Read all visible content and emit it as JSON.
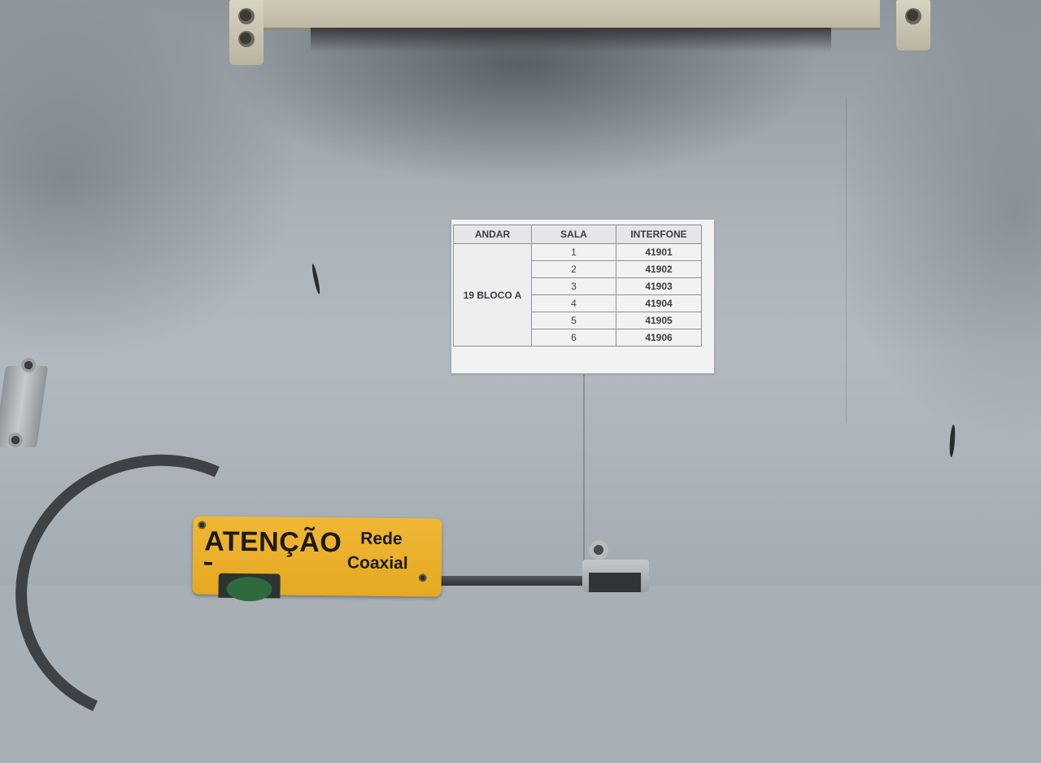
{
  "label_sheet": {
    "headers": [
      "ANDAR",
      "SALA",
      "INTERFONE"
    ],
    "andar": "19 BLOCO A",
    "rows": [
      {
        "sala": "1",
        "interfone": "41901"
      },
      {
        "sala": "2",
        "interfone": "41902"
      },
      {
        "sala": "3",
        "interfone": "41903"
      },
      {
        "sala": "4",
        "interfone": "41904"
      },
      {
        "sala": "5",
        "interfone": "41905"
      },
      {
        "sala": "6",
        "interfone": "41906"
      }
    ]
  },
  "warning_sign": {
    "title": "ATENÇÃO",
    "line1": "Rede",
    "line2": "Coaxial",
    "color": "#e9ae28"
  },
  "colors": {
    "wall": "#aab2b8",
    "paper": "#f1f2f2"
  }
}
